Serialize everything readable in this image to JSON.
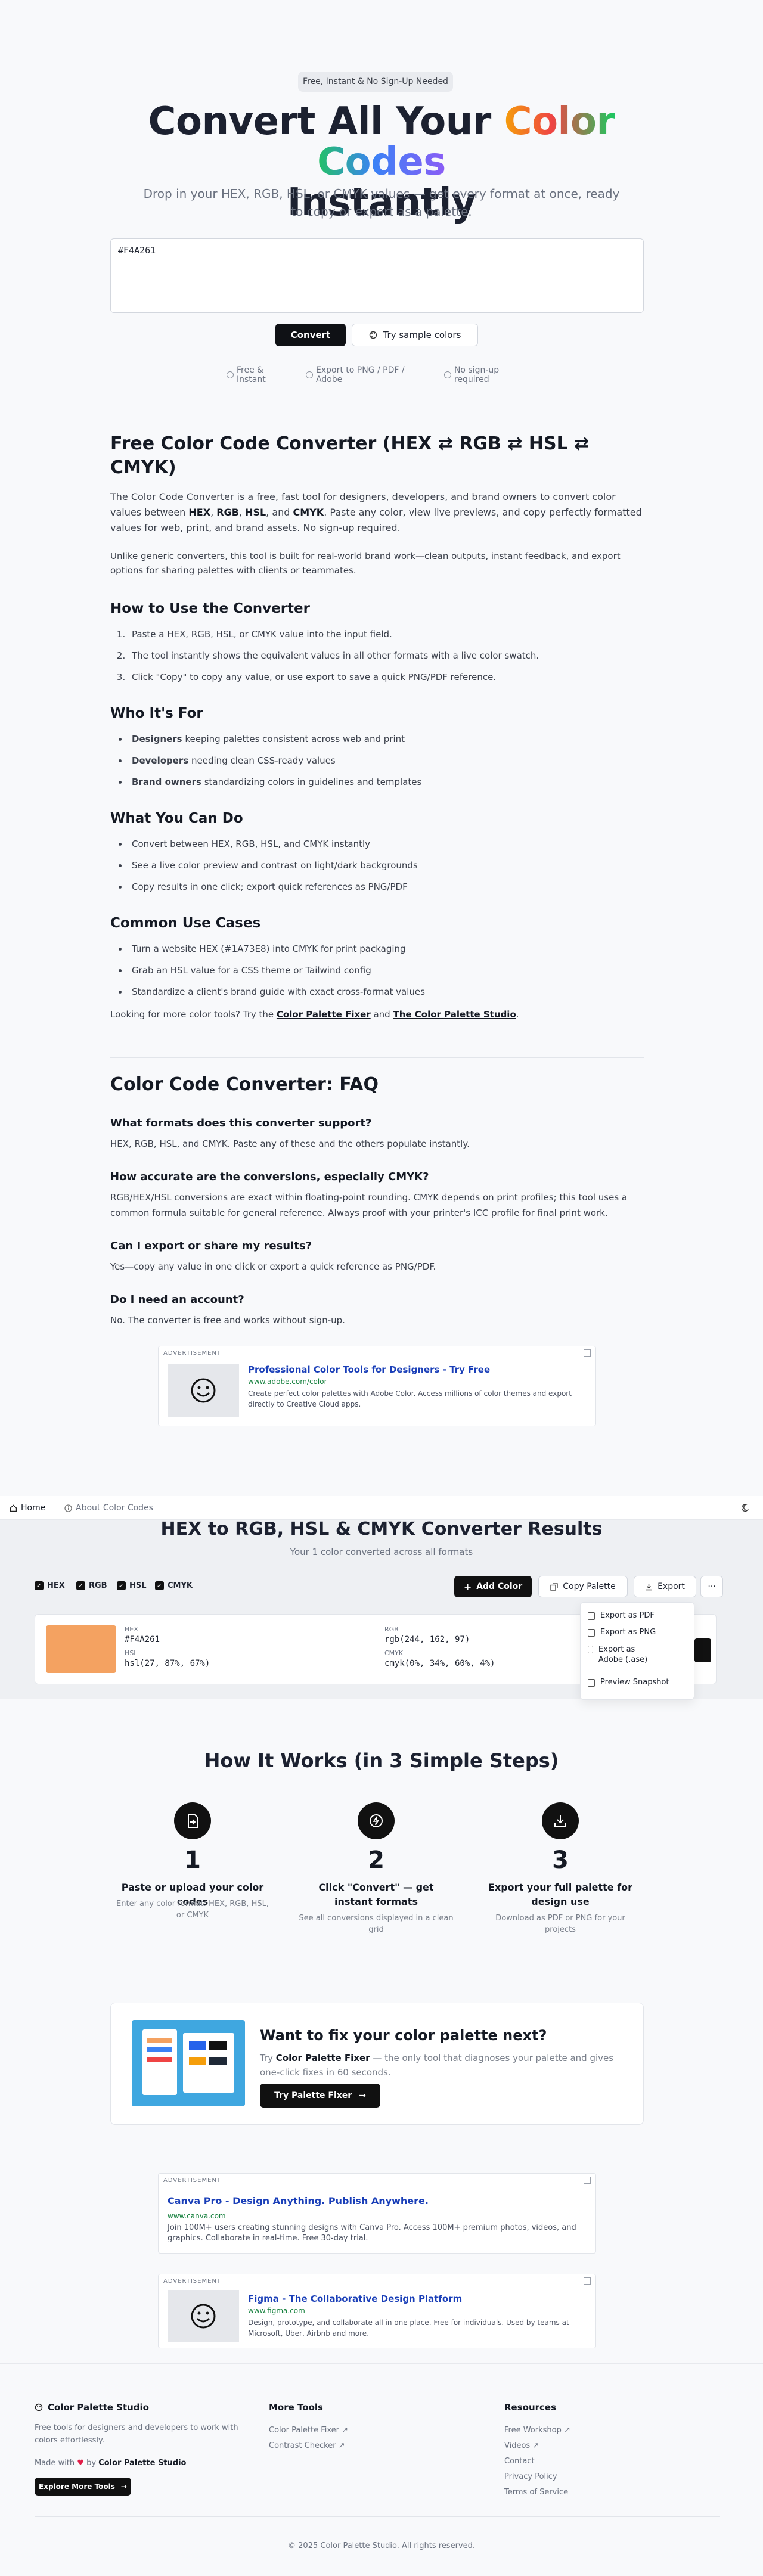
{
  "hero": {
    "badge": "Free, Instant & No Sign-Up Needed",
    "title_part1": "Convert All Your ",
    "title_highlight": "Color Codes",
    "title_part2": "Instantly",
    "subtitle": "Drop in your HEX, RGB, HSL, or CMYK values — get every format at once, ready to copy or export as a palette.",
    "input_value": "#F4A261",
    "convert_label": "Convert",
    "sample_label": "Try sample colors",
    "perks": [
      "Free & Instant",
      "Export to PNG / PDF / Adobe",
      "No sign-up required"
    ]
  },
  "article": {
    "title": "Free Color Code Converter (HEX ⇄ RGB ⇄ HSL ⇄ CMYK)",
    "intro_a": "The Color Code Converter is a free, fast tool for designers, developers, and brand owners to convert color values between ",
    "intro_hex": "HEX",
    "intro_sep1": ", ",
    "intro_rgb": "RGB",
    "intro_sep2": ", ",
    "intro_hsl": "HSL",
    "intro_sep3": ", and ",
    "intro_cmyk": "CMYK",
    "intro_b": ". Paste any color, view live previews, and copy perfectly formatted values for web, print, and brand assets. No sign-up required.",
    "intro2": "Unlike generic converters, this tool is built for real-world brand work—clean outputs, instant feedback, and export options for sharing palettes with clients or teammates.",
    "how_title": "How to Use the Converter",
    "how_steps": [
      "Paste a HEX, RGB, HSL, or CMYK value into the input field.",
      "The tool instantly shows the equivalent values in all other formats with a live color swatch.",
      "Click \"Copy\" to copy any value, or use export to save a quick PNG/PDF reference."
    ],
    "who_title": "Who It's For",
    "who": [
      {
        "b": "Designers",
        "t": " keeping palettes consistent across web and print"
      },
      {
        "b": "Developers",
        "t": " needing clean CSS-ready values"
      },
      {
        "b": "Brand owners",
        "t": " standardizing colors in guidelines and templates"
      }
    ],
    "can_title": "What You Can Do",
    "can": [
      "Convert between HEX, RGB, HSL, and CMYK instantly",
      "See a live color preview and contrast on light/dark backgrounds",
      "Copy results in one click; export quick references as PNG/PDF"
    ],
    "use_title": "Common Use Cases",
    "use": [
      "Turn a website HEX (#1A73E8) into CMYK for print packaging",
      "Grab an HSL value for a CSS theme or Tailwind config",
      "Standardize a client's brand guide with exact cross-format values"
    ],
    "more_a": "Looking for more color tools? Try the ",
    "more_link1": "Color Palette Fixer",
    "more_mid": " and ",
    "more_link2": "The Color Palette Studio",
    "more_end": "."
  },
  "faq": {
    "title": "Color Code Converter: FAQ",
    "items": [
      {
        "q": "What formats does this converter support?",
        "a": "HEX, RGB, HSL, and CMYK. Paste any of these and the others populate instantly."
      },
      {
        "q": "How accurate are the conversions, especially CMYK?",
        "a": "RGB/HEX/HSL conversions are exact within floating-point rounding. CMYK depends on print profiles; this tool uses a common formula suitable for general reference. Always proof with your printer's ICC profile for final print work."
      },
      {
        "q": "Can I export or share my results?",
        "a": "Yes—copy any value in one click or export a quick reference as PNG/PDF."
      },
      {
        "q": "Do I need an account?",
        "a": "No. The converter is free and works without sign-up."
      }
    ]
  },
  "ads": {
    "label": "ADVERTISEMENT",
    "ad1": {
      "title": "Professional Color Tools for Designers - Try Free",
      "url": "www.adobe.com/color",
      "desc": "Create perfect color palettes with Adobe Color. Access millions of color themes and export directly to Creative Cloud apps."
    },
    "ad2": {
      "title": "Canva Pro - Design Anything. Publish Anywhere.",
      "url": "www.canva.com",
      "desc": "Join 100M+ users creating stunning designs with Canva Pro. Access 100M+ premium photos, videos, and graphics. Collaborate in real-time. Free 30-day trial."
    },
    "ad3": {
      "title": "Figma - The Collaborative Design Platform",
      "url": "www.figma.com",
      "desc": "Design, prototype, and collaborate all in one place. Free for individuals. Used by teams at Microsoft, Uber, Airbnb and more."
    }
  },
  "nav": {
    "home": "Home",
    "about": "About Color Codes"
  },
  "results": {
    "title": "HEX to RGB, HSL & CMYK Converter Results",
    "subtitle": "Your 1 color converted across all formats",
    "formats": [
      "HEX",
      "RGB",
      "HSL",
      "CMYK"
    ],
    "add_color": "Add Color",
    "copy_palette": "Copy Palette",
    "export": "Export",
    "more": "···",
    "color": {
      "swatch": "#F4A261",
      "hex_label": "HEX",
      "hex": "#F4A261",
      "hsl_label": "HSL",
      "hsl": "hsl(27, 87%, 67%)",
      "rgb_label": "RGB",
      "rgb": "rgb(244, 162, 97)",
      "cmyk_label": "CMYK",
      "cmyk": "cmyk(0%, 34%, 60%, 4%)"
    },
    "menu": [
      "Export as PDF",
      "Export as PNG",
      "Export as Adobe (.ase)",
      "Preview Snapshot"
    ]
  },
  "how": {
    "title": "How It Works (in 3 Simple Steps)",
    "steps": [
      {
        "num": "1",
        "title": "Paste or upload your color codes",
        "desc": "Enter any color format: HEX, RGB, HSL, or CMYK"
      },
      {
        "num": "2",
        "title": "Click \"Convert\" — get instant formats",
        "desc": "See all conversions displayed in a clean grid"
      },
      {
        "num": "3",
        "title": "Export your full palette for design use",
        "desc": "Download as PDF or PNG for your projects"
      }
    ]
  },
  "cta": {
    "title": "Want to fix your color palette next?",
    "text_a": "Try ",
    "text_b": "Color Palette Fixer",
    "text_c": " — the only tool that diagnoses your palette and gives one-click fixes in 60 seconds.",
    "button": "Try Palette Fixer"
  },
  "footer": {
    "brand": "Color Palette Studio",
    "tagline": "Free tools for designers and developers to work with colors effortlessly.",
    "made_a": "Made with ",
    "made_b": " by ",
    "made_brand": "Color Palette Studio",
    "explore": "Explore More Tools",
    "more_tools_head": "More Tools",
    "more_tools": [
      "Color Palette Fixer",
      "Contrast Checker"
    ],
    "resources_head": "Resources",
    "resources": [
      "Free Workshop",
      "Videos",
      "Contact",
      "Privacy Policy",
      "Terms of Service"
    ],
    "copyright": "© 2025 Color Palette Studio. All rights reserved."
  },
  "colors": {
    "accent": "#0f1115",
    "swatch": "#F4A261",
    "link_ad": "#1a3fb8",
    "ad_url": "#15803d"
  }
}
